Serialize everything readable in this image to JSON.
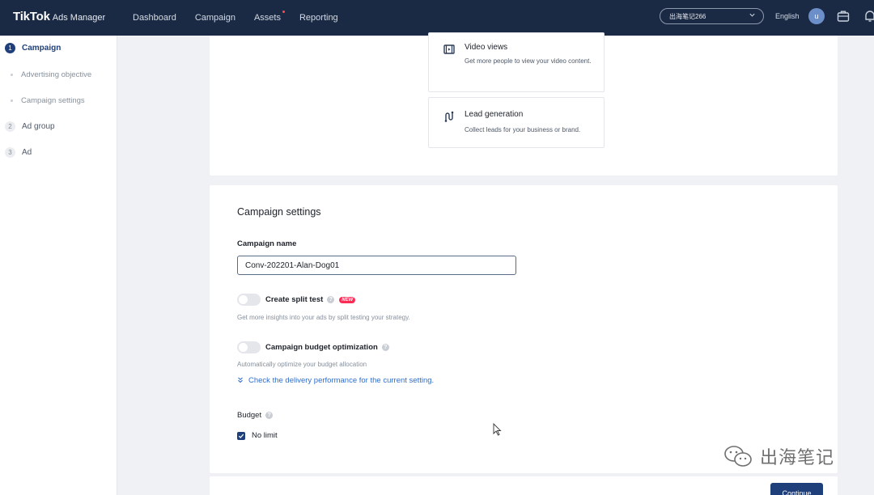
{
  "brand": {
    "name": "TikTok",
    "sub": "Ads Manager"
  },
  "nav": [
    {
      "label": "Dashboard"
    },
    {
      "label": "Campaign"
    },
    {
      "label": "Assets",
      "dot": true
    },
    {
      "label": "Reporting"
    }
  ],
  "account": {
    "name": "出海笔记266"
  },
  "language": "English",
  "avatar_letter": "u",
  "sidebar": {
    "steps": [
      {
        "number": "1",
        "label": "Campaign",
        "active": true
      },
      {
        "label": "Advertising objective"
      },
      {
        "label": "Campaign settings"
      },
      {
        "number": "2",
        "label": "Ad group"
      },
      {
        "number": "3",
        "label": "Ad"
      }
    ]
  },
  "objectives": [
    {
      "title": "Video views",
      "desc": "Get more people to view your video content.",
      "icon": "film-icon"
    },
    {
      "title": "Lead generation",
      "desc": "Collect leads for your business or brand.",
      "icon": "lead-icon"
    }
  ],
  "settings": {
    "title": "Campaign settings",
    "name_label": "Campaign name",
    "name_value": "Conv-202201-Alan-Dog01",
    "split_test_label": "Create split test",
    "split_test_badge": "NEW",
    "split_test_hint": "Get more insights into your ads by split testing your strategy.",
    "cbo_label": "Campaign budget optimization",
    "cbo_hint": "Automatically optimize your budget allocation",
    "delivery_link": "Check the delivery performance for the current setting.",
    "budget_label": "Budget",
    "no_limit_label": "No limit"
  },
  "footer": {
    "continue_label": "Continue"
  },
  "watermark": "出海笔记"
}
